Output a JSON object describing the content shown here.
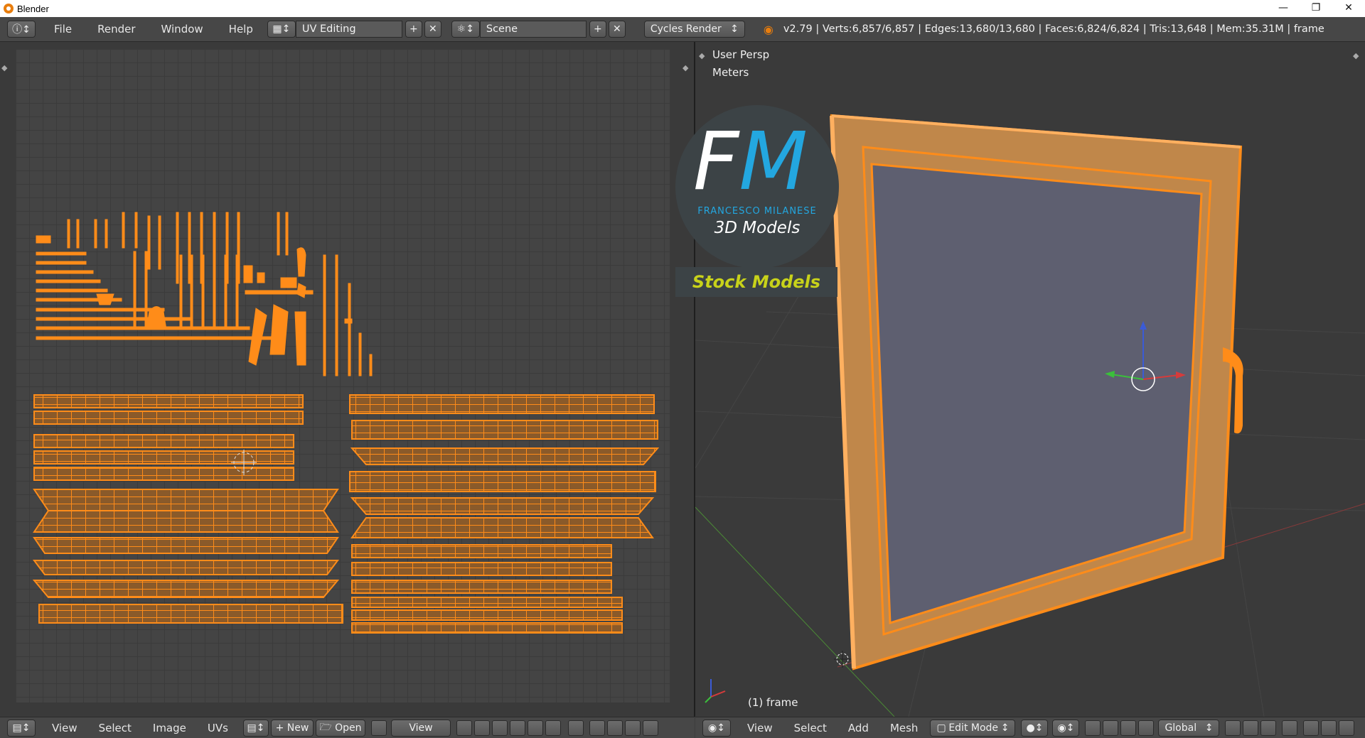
{
  "window": {
    "title": "Blender",
    "minimize_icon": "minimize-icon",
    "maximize_icon": "restore-icon",
    "close_icon": "close-icon"
  },
  "topbar": {
    "menus": [
      "File",
      "Render",
      "Window",
      "Help"
    ],
    "screen_layout": "UV Editing",
    "scene": "Scene",
    "render_engine": "Cycles Render",
    "stats": "v2.79 | Verts:6,857/6,857 | Edges:13,680/13,680 | Faces:6,824/6,824 | Tris:13,648 | Mem:35.31M | frame"
  },
  "viewport": {
    "view_name": "User Persp",
    "units": "Meters",
    "object_label": "(1) frame"
  },
  "watermark": {
    "letter_f": "F",
    "letter_m": "M",
    "name": "FRANCESCO MILANESE",
    "subtitle": "3D Models",
    "banner": "Stock Models"
  },
  "uv_header": {
    "menus": [
      "View",
      "Select",
      "Image",
      "UVs"
    ],
    "new_label": "New",
    "open_label": "Open",
    "view_label": "View"
  },
  "viewport_header": {
    "menus": [
      "View",
      "Select",
      "Add",
      "Mesh"
    ],
    "mode": "Edit Mode",
    "orientation": "Global"
  },
  "colors": {
    "accent": "#ff8c19",
    "brand_blue": "#23a7e0",
    "stock_yellow": "#c8d21a"
  }
}
